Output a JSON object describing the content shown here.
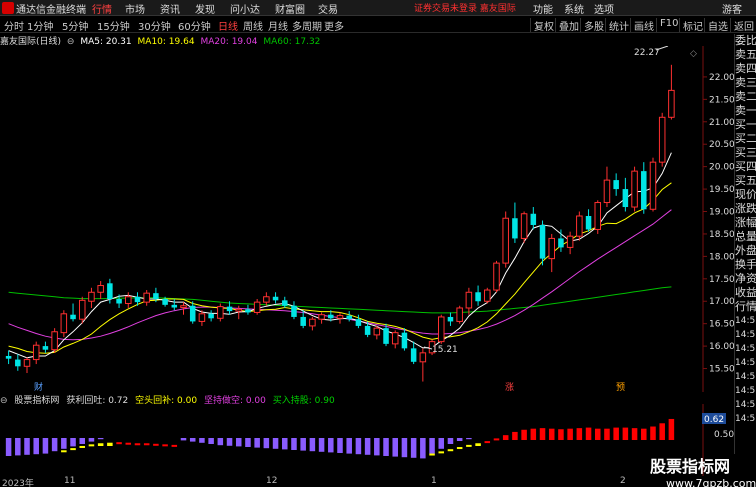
{
  "menubar": {
    "app_name": "通达信金融终端",
    "menus": [
      "行情",
      "市场",
      "资讯",
      "发现",
      "问小达",
      "财富圈",
      "交易"
    ],
    "active_menu": "行情",
    "notice": "证券交易未登录",
    "stock_name_link": "嘉友国际",
    "right_menus": [
      "功能",
      "系统",
      "选项",
      "游客"
    ]
  },
  "toolbar": {
    "periods": [
      "分时",
      "1分钟",
      "5分钟",
      "15分钟",
      "30分钟",
      "60分钟",
      "日线",
      "周线",
      "月线",
      "多周期",
      "更多"
    ],
    "active_period": "日线",
    "buttons": [
      "复权",
      "叠加",
      "多股",
      "统计",
      "画线",
      "F10",
      "标记",
      "自选",
      "返回"
    ]
  },
  "ma_legend": {
    "title": "嘉友国际(日线)",
    "ma5": "MA5: 20.31",
    "ma10": "MA10: 19.64",
    "ma20": "MA20: 19.04",
    "ma60": "MA60: 17.32"
  },
  "colors": {
    "up": "#ff3030",
    "down": "#00e5e5",
    "ma5": "#ffffff",
    "ma10": "#ffff00",
    "ma20": "#e040e0",
    "ma60": "#00c000",
    "up_bar": "#ff0000",
    "positive_bar": "#ffff00",
    "negative_bar": "#8a5cff"
  },
  "price_axis": [
    "22.00",
    "21.50",
    "21.00",
    "20.50",
    "20.00",
    "19.50",
    "19.00",
    "18.50",
    "18.00",
    "17.50",
    "17.00",
    "16.50",
    "16.00",
    "15.50"
  ],
  "price_annotations": {
    "high": "22.27",
    "low": "15.21",
    "marker1": "财",
    "marker2": "涨",
    "marker3": "预"
  },
  "sidepanel": {
    "items": [
      "委比",
      "卖五",
      "卖四",
      "卖三",
      "卖二",
      "卖一",
      "买一",
      "买二",
      "买三",
      "买四",
      "买五",
      "现价",
      "涨跌",
      "涨幅",
      "总量",
      "外盘",
      "换手",
      "净资",
      "收益",
      "行情"
    ],
    "times": [
      "14:5",
      "14:5",
      "14:5",
      "14:5",
      "14:5",
      "14:5",
      "14:5",
      "14:5"
    ]
  },
  "indicator_legend": {
    "name": "股票指标网",
    "v1": "获利回吐: 0.72",
    "v2": "空头回补: 0.00",
    "v3": "坚持做空: 0.00",
    "v4": "买入持股: 0.90"
  },
  "indicator_axis": {
    "current": "0.62",
    "mid": "0.50"
  },
  "date_axis": [
    "2023年",
    "11",
    "12",
    "1",
    "2"
  ],
  "watermark": {
    "line1": "股票指标网",
    "line2": "www.7gpzb.com"
  },
  "chart_data": {
    "type": "candlestick",
    "price_ylim": [
      15.2,
      22.6
    ],
    "candles": [
      [
        15.78,
        15.9,
        15.6,
        15.72
      ],
      [
        15.7,
        15.82,
        15.45,
        15.55
      ],
      [
        15.55,
        15.75,
        15.4,
        15.7
      ],
      [
        15.7,
        16.1,
        15.6,
        16.02
      ],
      [
        16.0,
        16.1,
        15.85,
        15.92
      ],
      [
        15.92,
        16.4,
        15.85,
        16.32
      ],
      [
        16.3,
        16.8,
        16.2,
        16.72
      ],
      [
        16.7,
        16.95,
        16.55,
        16.6
      ],
      [
        16.6,
        17.1,
        16.5,
        17.02
      ],
      [
        17.0,
        17.3,
        16.85,
        17.2
      ],
      [
        17.2,
        17.45,
        17.05,
        17.35
      ],
      [
        17.4,
        17.5,
        16.95,
        17.05
      ],
      [
        17.05,
        17.15,
        16.85,
        16.95
      ],
      [
        16.95,
        17.2,
        16.85,
        17.1
      ],
      [
        17.1,
        17.2,
        16.9,
        16.98
      ],
      [
        16.98,
        17.25,
        16.9,
        17.18
      ],
      [
        17.18,
        17.3,
        16.98,
        17.05
      ],
      [
        17.05,
        17.1,
        16.88,
        16.92
      ],
      [
        16.92,
        17.05,
        16.8,
        16.86
      ],
      [
        16.86,
        16.98,
        16.7,
        16.9
      ],
      [
        16.9,
        17.0,
        16.5,
        16.55
      ],
      [
        16.55,
        16.8,
        16.45,
        16.72
      ],
      [
        16.72,
        16.8,
        16.55,
        16.62
      ],
      [
        16.62,
        16.95,
        16.55,
        16.88
      ],
      [
        16.88,
        17.0,
        16.7,
        16.78
      ],
      [
        16.78,
        16.9,
        16.6,
        16.82
      ],
      [
        16.82,
        16.92,
        16.7,
        16.75
      ],
      [
        16.75,
        17.05,
        16.7,
        16.98
      ],
      [
        16.98,
        17.2,
        16.9,
        17.1
      ],
      [
        17.1,
        17.2,
        16.95,
        17.02
      ],
      [
        17.02,
        17.1,
        16.85,
        16.9
      ],
      [
        16.9,
        17.0,
        16.6,
        16.65
      ],
      [
        16.65,
        16.8,
        16.4,
        16.45
      ],
      [
        16.45,
        16.65,
        16.35,
        16.6
      ],
      [
        16.6,
        16.75,
        16.5,
        16.7
      ],
      [
        16.7,
        16.8,
        16.55,
        16.62
      ],
      [
        16.62,
        16.75,
        16.5,
        16.68
      ],
      [
        16.68,
        16.78,
        16.55,
        16.6
      ],
      [
        16.6,
        16.7,
        16.4,
        16.45
      ],
      [
        16.45,
        16.55,
        16.2,
        16.25
      ],
      [
        16.25,
        16.45,
        16.15,
        16.4
      ],
      [
        16.4,
        16.5,
        16.0,
        16.05
      ],
      [
        16.05,
        16.35,
        15.95,
        16.3
      ],
      [
        16.3,
        16.4,
        15.9,
        15.95
      ],
      [
        15.95,
        16.1,
        15.6,
        15.65
      ],
      [
        15.65,
        15.95,
        15.21,
        15.85
      ],
      [
        15.85,
        16.15,
        15.8,
        16.1
      ],
      [
        16.1,
        16.7,
        16.05,
        16.65
      ],
      [
        16.65,
        16.75,
        16.45,
        16.55
      ],
      [
        16.55,
        16.9,
        16.5,
        16.85
      ],
      [
        16.85,
        17.3,
        16.7,
        17.2
      ],
      [
        17.2,
        17.35,
        16.9,
        17.0
      ],
      [
        17.0,
        17.3,
        16.95,
        17.25
      ],
      [
        17.25,
        17.9,
        17.2,
        17.85
      ],
      [
        17.85,
        19.0,
        17.75,
        18.85
      ],
      [
        18.85,
        19.2,
        18.3,
        18.4
      ],
      [
        18.4,
        19.0,
        18.3,
        18.95
      ],
      [
        18.95,
        19.1,
        18.6,
        18.7
      ],
      [
        18.7,
        18.8,
        17.8,
        17.95
      ],
      [
        17.95,
        18.5,
        17.65,
        18.4
      ],
      [
        18.4,
        18.6,
        18.1,
        18.2
      ],
      [
        18.2,
        18.55,
        18.05,
        18.45
      ],
      [
        18.45,
        19.0,
        18.35,
        18.9
      ],
      [
        18.9,
        19.05,
        18.55,
        18.6
      ],
      [
        18.6,
        19.25,
        18.5,
        19.2
      ],
      [
        19.2,
        20.0,
        19.1,
        19.7
      ],
      [
        19.7,
        19.85,
        19.35,
        19.5
      ],
      [
        19.5,
        19.75,
        19.0,
        19.1
      ],
      [
        19.1,
        20.0,
        19.0,
        19.9
      ],
      [
        19.9,
        20.1,
        18.95,
        19.05
      ],
      [
        19.05,
        20.2,
        19.0,
        20.1
      ],
      [
        20.1,
        21.2,
        20.0,
        21.1
      ],
      [
        21.1,
        22.27,
        21.05,
        21.7
      ]
    ],
    "ma5": [
      15.9,
      15.82,
      15.74,
      15.78,
      15.78,
      15.9,
      16.14,
      16.32,
      16.52,
      16.77,
      16.98,
      17.04,
      17.11,
      17.13,
      17.09,
      17.05,
      17.05,
      17.02,
      16.98,
      16.98,
      16.84,
      16.76,
      16.73,
      16.73,
      16.71,
      16.76,
      16.77,
      16.84,
      16.89,
      16.93,
      16.95,
      16.89,
      16.78,
      16.68,
      16.6,
      16.58,
      16.61,
      16.62,
      16.57,
      16.5,
      16.44,
      16.34,
      16.27,
      16.19,
      16.08,
      15.96,
      15.97,
      16.12,
      16.24,
      16.4,
      16.67,
      16.85,
      16.97,
      17.21,
      17.63,
      17.96,
      18.33,
      18.63,
      18.7,
      18.67,
      18.5,
      18.34,
      18.38,
      18.51,
      18.67,
      18.97,
      19.13,
      19.29,
      19.44,
      19.45,
      19.53,
      19.85,
      20.31
    ],
    "ma10": [
      16.0,
      15.95,
      15.88,
      15.85,
      15.84,
      15.86,
      15.98,
      16.06,
      16.15,
      16.27,
      16.44,
      16.59,
      16.72,
      16.83,
      16.93,
      17.01,
      17.02,
      17.05,
      17.05,
      17.04,
      16.95,
      16.9,
      16.87,
      16.85,
      16.84,
      16.8,
      16.77,
      16.79,
      16.81,
      16.82,
      16.86,
      16.83,
      16.81,
      16.79,
      16.77,
      16.77,
      16.75,
      16.7,
      16.63,
      16.55,
      16.51,
      16.48,
      16.44,
      16.38,
      16.29,
      16.2,
      16.15,
      16.19,
      16.21,
      16.24,
      16.32,
      16.41,
      16.54,
      16.72,
      16.94,
      17.16,
      17.41,
      17.65,
      17.89,
      18.07,
      18.24,
      18.36,
      18.5,
      18.57,
      18.67,
      18.74,
      18.73,
      18.83,
      18.97,
      19.06,
      19.25,
      19.49,
      19.64
    ],
    "ma20": [
      16.5,
      16.42,
      16.35,
      16.28,
      16.22,
      16.18,
      16.15,
      16.14,
      16.15,
      16.18,
      16.22,
      16.28,
      16.35,
      16.43,
      16.52,
      16.6,
      16.68,
      16.74,
      16.79,
      16.83,
      16.86,
      16.87,
      16.87,
      16.86,
      16.85,
      16.84,
      16.83,
      16.82,
      16.81,
      16.8,
      16.79,
      16.77,
      16.75,
      16.72,
      16.69,
      16.66,
      16.63,
      16.6,
      16.56,
      16.52,
      16.48,
      16.44,
      16.4,
      16.36,
      16.32,
      16.29,
      16.27,
      16.27,
      16.28,
      16.3,
      16.33,
      16.37,
      16.42,
      16.49,
      16.58,
      16.68,
      16.8,
      16.93,
      17.07,
      17.21,
      17.36,
      17.51,
      17.66,
      17.8,
      17.94,
      18.07,
      18.2,
      18.33,
      18.46,
      18.59,
      18.72,
      18.88,
      19.04
    ],
    "ma60": [
      17.2,
      17.18,
      17.16,
      17.14,
      17.12,
      17.1,
      17.08,
      17.07,
      17.06,
      17.06,
      17.06,
      17.06,
      17.07,
      17.07,
      17.08,
      17.08,
      17.08,
      17.07,
      17.06,
      17.05,
      17.04,
      17.02,
      17.0,
      16.98,
      16.96,
      16.95,
      16.94,
      16.93,
      16.92,
      16.91,
      16.9,
      16.89,
      16.88,
      16.87,
      16.86,
      16.85,
      16.84,
      16.83,
      16.82,
      16.81,
      16.8,
      16.79,
      16.78,
      16.77,
      16.76,
      16.75,
      16.74,
      16.74,
      16.74,
      16.75,
      16.76,
      16.77,
      16.78,
      16.8,
      16.82,
      16.84,
      16.86,
      16.88,
      16.91,
      16.94,
      16.97,
      17.0,
      17.03,
      17.06,
      17.09,
      17.12,
      17.15,
      17.18,
      17.21,
      17.24,
      17.27,
      17.3,
      17.32
    ],
    "indicator_ylim": [
      0,
      1
    ],
    "indicator_bars": [
      0.15,
      0.14,
      0.13,
      0.12,
      0.12,
      0.18,
      0.22,
      0.26,
      0.3,
      0.33,
      0.35,
      0.36,
      0.36,
      0.35,
      0.34,
      0.34,
      0.33,
      0.32,
      0.31,
      0.3,
      0.29,
      0.28,
      0.27,
      0.26,
      0.26,
      0.26,
      0.27,
      0.28,
      0.29,
      0.3,
      0.3,
      0.29,
      0.28,
      0.27,
      0.26,
      0.24,
      0.22,
      0.2,
      0.19,
      0.18,
      0.17,
      0.16,
      0.15,
      0.14,
      0.13,
      0.12,
      0.14,
      0.18,
      0.22,
      0.26,
      0.3,
      0.33,
      0.37,
      0.42,
      0.48,
      0.54,
      0.58,
      0.6,
      0.61,
      0.6,
      0.59,
      0.6,
      0.61,
      0.62,
      0.6,
      0.6,
      0.62,
      0.62,
      0.61,
      0.6,
      0.64,
      0.7,
      0.78
    ],
    "indicator_kinds": [
      "n",
      "n",
      "n",
      "n",
      "n",
      "n",
      "y",
      "y",
      "y",
      "y",
      "y",
      "y",
      "r",
      "r",
      "r",
      "r",
      "r",
      "r",
      "r",
      "n",
      "n",
      "n",
      "n",
      "n",
      "n",
      "n",
      "n",
      "n",
      "n",
      "n",
      "n",
      "n",
      "n",
      "n",
      "n",
      "n",
      "n",
      "n",
      "n",
      "n",
      "n",
      "n",
      "n",
      "n",
      "n",
      "n",
      "y",
      "y",
      "y",
      "y",
      "y",
      "y",
      "r",
      "r",
      "r",
      "r",
      "r",
      "r",
      "r",
      "r",
      "r",
      "r",
      "r",
      "r",
      "r",
      "r",
      "r",
      "r",
      "r",
      "r",
      "r",
      "r",
      "r"
    ],
    "indicator_upper": [
      0.1,
      0.1,
      0.1,
      0.1,
      0.11,
      0.15,
      0.18,
      0.22,
      0.26,
      0.29,
      0.31,
      0.32,
      0.33,
      0.32,
      0.31,
      0.31,
      0.3,
      0.29,
      0.28,
      0.27,
      0.26,
      0.25,
      0.24,
      0.24,
      0.24,
      0.24,
      0.25,
      0.26,
      0.27,
      0.28,
      0.28,
      0.27,
      0.26,
      0.25,
      0.23,
      0.21,
      0.19,
      0.18,
      0.17,
      0.16,
      0.15,
      0.14,
      0.13,
      0.12,
      0.11,
      0.1,
      0.12,
      0.16,
      0.2,
      0.24,
      0.28,
      0.31,
      0.35,
      0.4,
      0.46,
      0.52,
      0.56,
      0.58,
      0.59,
      0.58,
      0.57,
      0.58,
      0.59,
      0.6,
      0.58,
      0.58,
      0.6,
      0.6,
      0.59,
      0.58,
      0.62,
      0.68,
      0.76
    ],
    "indicator_negative": [
      0.3,
      0.29,
      0.28,
      0.27,
      0.26,
      0.22,
      0.18,
      0.14,
      0.1,
      0.06,
      0.02,
      0.0,
      0.0,
      0.0,
      0.0,
      0.0,
      0.0,
      0.0,
      0.0,
      0.04,
      0.06,
      0.08,
      0.1,
      0.12,
      0.13,
      0.14,
      0.15,
      0.16,
      0.17,
      0.18,
      0.19,
      0.2,
      0.21,
      0.22,
      0.23,
      0.24,
      0.25,
      0.26,
      0.27,
      0.28,
      0.29,
      0.3,
      0.31,
      0.32,
      0.33,
      0.34,
      0.26,
      0.18,
      0.1,
      0.05,
      0.02,
      0.0,
      0.0,
      0.0,
      0.0,
      0.0,
      0.0,
      0.0,
      0.0,
      0.0,
      0.0,
      0.0,
      0.0,
      0.0,
      0.0,
      0.0,
      0.0,
      0.0,
      0.0,
      0.0,
      0.0,
      0.0,
      0.0
    ]
  }
}
